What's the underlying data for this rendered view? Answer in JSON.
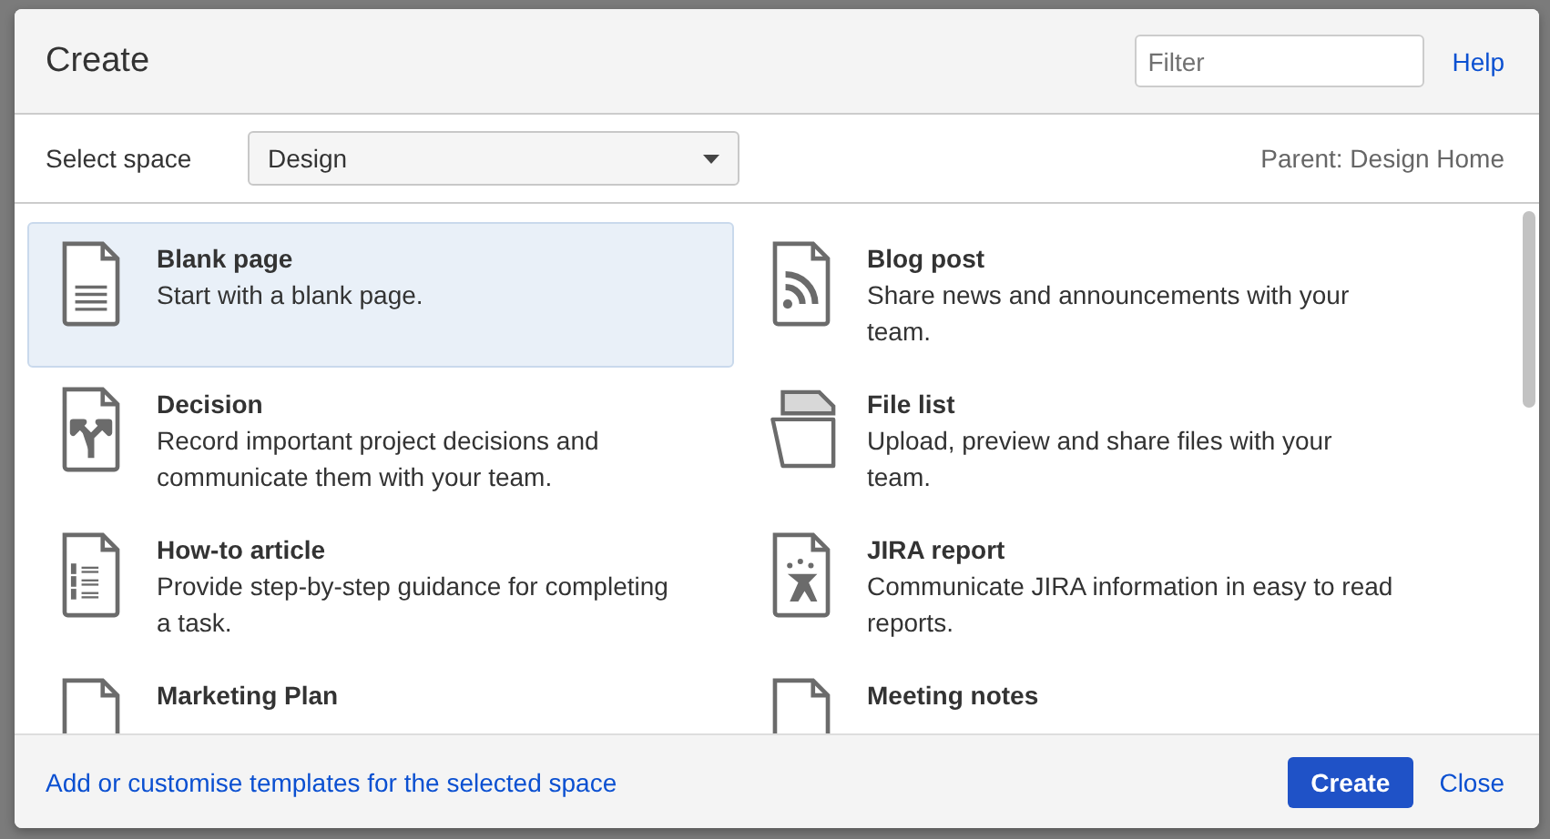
{
  "dialog": {
    "title": "Create",
    "filter": {
      "placeholder": "Filter"
    },
    "help": "Help"
  },
  "space": {
    "label": "Select space",
    "value": "Design",
    "parent": "Parent: Design Home"
  },
  "templates": [
    {
      "kind": "blank",
      "title": "Blank page",
      "description": "Start with a blank page.",
      "selected": true
    },
    {
      "kind": "blog",
      "title": "Blog post",
      "description": "Share news and announcements with your team.",
      "selected": false
    },
    {
      "kind": "decision",
      "title": "Decision",
      "description": "Record important project decisions and communicate them with your team.",
      "selected": false
    },
    {
      "kind": "files",
      "title": "File list",
      "description": "Upload, preview and share files with your team.",
      "selected": false
    },
    {
      "kind": "howto",
      "title": "How-to article",
      "description": "Provide step-by-step guidance for completing a task.",
      "selected": false
    },
    {
      "kind": "jira",
      "title": "JIRA report",
      "description": "Communicate JIRA information in easy to read reports.",
      "selected": false
    },
    {
      "kind": "marketing",
      "title": "Marketing Plan",
      "selected": false
    },
    {
      "kind": "meeting",
      "title": "Meeting notes",
      "selected": false
    }
  ],
  "footer": {
    "link": "Add or customise templates for the selected space",
    "primary": "Create",
    "close": "Close"
  }
}
